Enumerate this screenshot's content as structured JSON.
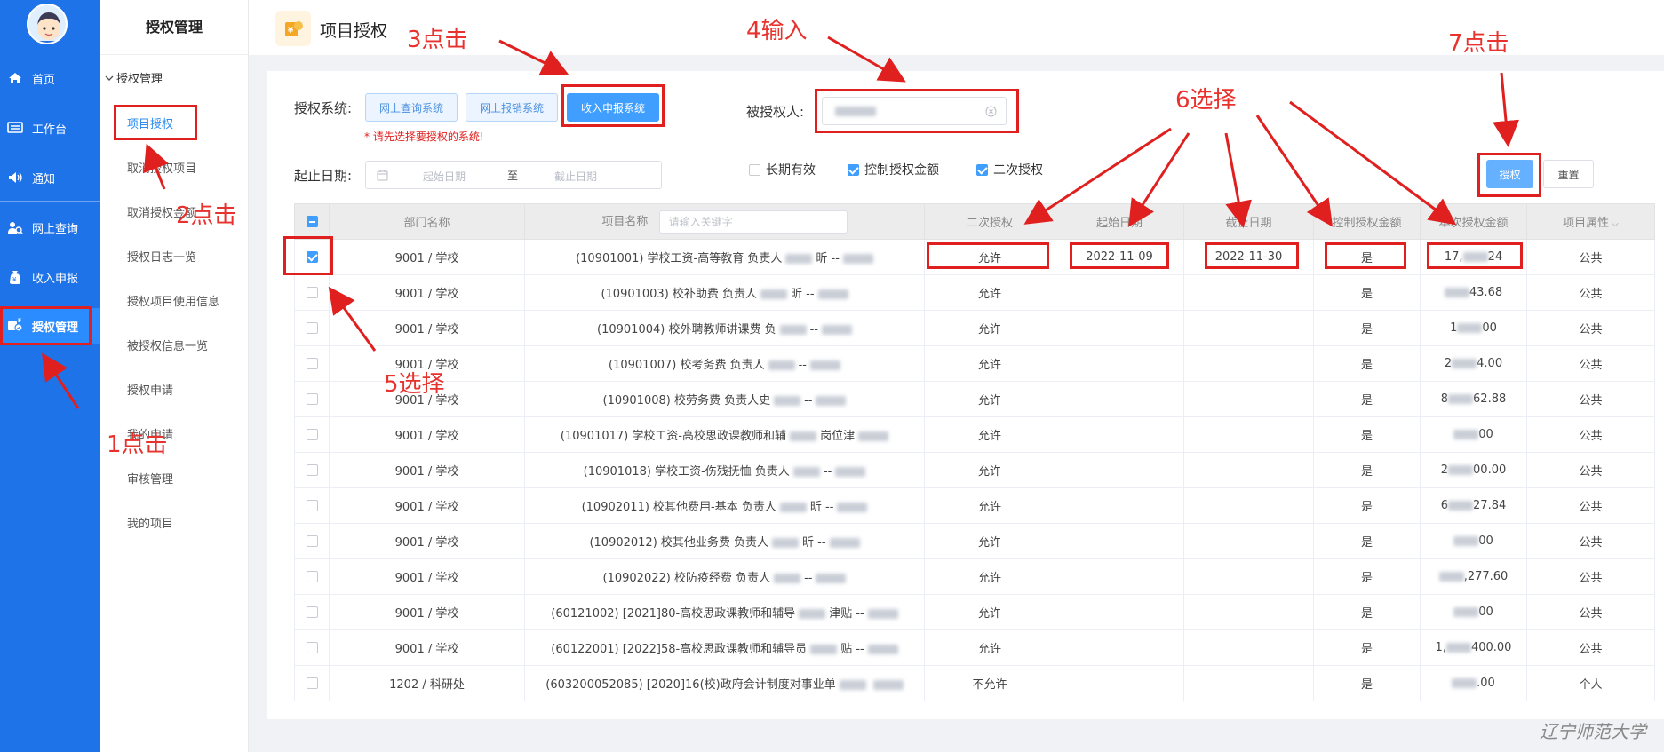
{
  "rail": {
    "items": [
      {
        "label": "首页",
        "icon": "home-icon"
      },
      {
        "label": "工作台",
        "icon": "workbench-icon"
      },
      {
        "label": "通知",
        "icon": "speaker-icon"
      },
      {
        "label": "网上查询",
        "icon": "query-icon"
      },
      {
        "label": "收入申报",
        "icon": "money-bag-icon"
      },
      {
        "label": "授权管理",
        "icon": "authorization-icon"
      }
    ]
  },
  "sidebar": {
    "title": "授权管理",
    "group": "授权管理",
    "items": [
      "项目授权",
      "取消授权项目",
      "取消授权金额",
      "授权日志一览",
      "授权项目使用信息",
      "被授权信息一览",
      "授权申请",
      "我的申请",
      "审核管理",
      "我的项目"
    ]
  },
  "header": {
    "title": "项目授权"
  },
  "form": {
    "system_label": "授权系统:",
    "systems": [
      "网上查询系统",
      "网上报销系统",
      "收入申报系统"
    ],
    "hint": "* 请先选择要授权的系统!",
    "grantee_label": "被授权人:",
    "date_label": "起止日期:",
    "start_placeholder": "起始日期",
    "range_sep": "至",
    "end_placeholder": "截止日期",
    "options": [
      {
        "label": "长期有效",
        "checked": false
      },
      {
        "label": "控制授权金额",
        "checked": true
      },
      {
        "label": "二次授权",
        "checked": true
      }
    ],
    "authorize_button": "授权",
    "reset_button": "重置"
  },
  "table": {
    "headers": [
      "部门名称",
      "项目名称",
      "二次授权",
      "起始日期",
      "截止日期",
      "控制授权金额",
      "本次授权金额",
      "项目属性"
    ],
    "search_placeholder": "请输入关键字",
    "rows": [
      {
        "dept": "9001 / 学校",
        "name": "(10901001) 学校工资-高等教育 负责人",
        "name_tail": "昕 --",
        "secondary": "允许",
        "start": "2022-11-09",
        "end": "2022-11-30",
        "control": "是",
        "amount": "17,",
        "amount_tail": "24",
        "attr": "公共",
        "checked": true
      },
      {
        "dept": "9001 / 学校",
        "name": "(10901003) 校补助费 负责人",
        "name_tail": "昕 --",
        "secondary": "允许",
        "start": "",
        "end": "",
        "control": "是",
        "amount": "",
        "amount_tail": "43.68",
        "attr": "公共",
        "checked": false
      },
      {
        "dept": "9001 / 学校",
        "name": "(10901004) 校外聘教师讲课费 负",
        "name_tail": "--",
        "secondary": "允许",
        "start": "",
        "end": "",
        "control": "是",
        "amount": "1",
        "amount_tail": "00",
        "attr": "公共",
        "checked": false
      },
      {
        "dept": "9001 / 学校",
        "name": "(10901007) 校考务费 负责人",
        "name_tail": "--",
        "secondary": "允许",
        "start": "",
        "end": "",
        "control": "是",
        "amount": "2",
        "amount_tail": "4.00",
        "attr": "公共",
        "checked": false
      },
      {
        "dept": "9001 / 学校",
        "name": "(10901008) 校劳务费 负责人史",
        "name_tail": "--",
        "secondary": "允许",
        "start": "",
        "end": "",
        "control": "是",
        "amount": "8",
        "amount_tail": "62.88",
        "attr": "公共",
        "checked": false
      },
      {
        "dept": "9001 / 学校",
        "name": "(10901017) 学校工资-高校思政课教师和辅",
        "name_tail": "岗位津",
        "secondary": "允许",
        "start": "",
        "end": "",
        "control": "是",
        "amount": "",
        "amount_tail": "00",
        "attr": "公共",
        "checked": false
      },
      {
        "dept": "9001 / 学校",
        "name": "(10901018) 学校工资-伤残抚恤 负责人",
        "name_tail": "--",
        "secondary": "允许",
        "start": "",
        "end": "",
        "control": "是",
        "amount": "2",
        "amount_tail": "00.00",
        "attr": "公共",
        "checked": false
      },
      {
        "dept": "9001 / 学校",
        "name": "(10902011) 校其他费用-基本 负责人",
        "name_tail": "昕 --",
        "secondary": "允许",
        "start": "",
        "end": "",
        "control": "是",
        "amount": "6",
        "amount_tail": "27.84",
        "attr": "公共",
        "checked": false
      },
      {
        "dept": "9001 / 学校",
        "name": "(10902012) 校其他业务费 负责人",
        "name_tail": "昕 --",
        "secondary": "允许",
        "start": "",
        "end": "",
        "control": "是",
        "amount": "",
        "amount_tail": "00",
        "attr": "公共",
        "checked": false
      },
      {
        "dept": "9001 / 学校",
        "name": "(10902022) 校防疫经费 负责人",
        "name_tail": "--",
        "secondary": "允许",
        "start": "",
        "end": "",
        "control": "是",
        "amount": "",
        "amount_tail": ",277.60",
        "attr": "公共",
        "checked": false
      },
      {
        "dept": "9001 / 学校",
        "name": "(60121002) [2021]80-高校思政课教师和辅导",
        "name_tail": "津贴 --",
        "secondary": "允许",
        "start": "",
        "end": "",
        "control": "是",
        "amount": "",
        "amount_tail": "00",
        "attr": "公共",
        "checked": false
      },
      {
        "dept": "9001 / 学校",
        "name": "(60122001) [2022]58-高校思政课教师和辅导员",
        "name_tail": "贴 --",
        "secondary": "允许",
        "start": "",
        "end": "",
        "control": "是",
        "amount": "1,",
        "amount_tail": "400.00",
        "attr": "公共",
        "checked": false
      },
      {
        "dept": "1202 / 科研处",
        "name": "(603200052085) [2020]16(校)政府会计制度对事业单",
        "name_tail": "",
        "secondary": "不允许",
        "start": "",
        "end": "",
        "control": "是",
        "amount": "",
        "amount_tail": ".00",
        "attr": "个人",
        "checked": false
      }
    ]
  },
  "annotations": {
    "a1": "1点击",
    "a2": "2点击",
    "a3": "3点击",
    "a4": "4输入",
    "a5": "5选择",
    "a6": "6选择",
    "a7": "7点击",
    "color": "#e0201f"
  },
  "watermark": "辽宁师范大学",
  "colors": {
    "rail": "#1e73e8",
    "primary": "#409eff",
    "active_text": "#2d8cf0"
  }
}
